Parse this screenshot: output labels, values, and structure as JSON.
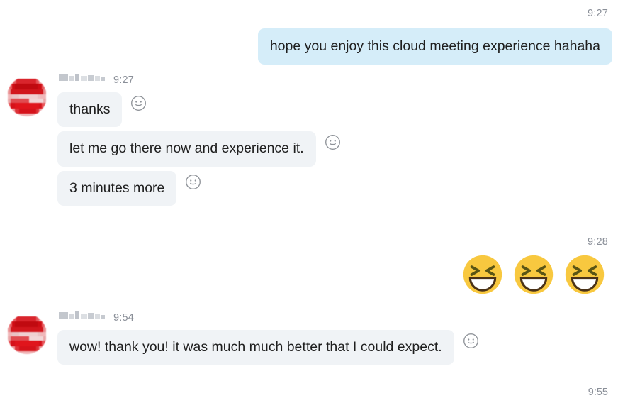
{
  "app": {
    "title": "Chat conversation",
    "background_color": "#ffffff"
  },
  "colors": {
    "outgoing_bubble": "#d5edf9",
    "incoming_bubble": "#f0f3f6",
    "timestamp_text": "#8a8f98",
    "message_text": "#1f1f1f",
    "avatar_red": "#dd0b12",
    "emoji_yellow": "#f7c842",
    "emoji_mouth_outline": "#4a3218",
    "reaction_icon_gray": "#8e9298"
  },
  "timestamps": {
    "first": "9:27",
    "sticker": "9:28",
    "bottom_cut_off": "9:55"
  },
  "messages": [
    {
      "id": "msg-outgoing-1",
      "direction": "outgoing",
      "text": "hope you enjoy this cloud meeting experience hahaha",
      "time": "9:27"
    },
    {
      "id": "msg-incoming-group-1",
      "direction": "incoming",
      "sender_name_redacted": true,
      "sender_name": "",
      "time": "9:27",
      "avatar": "pixelated-red-avatar",
      "bubbles": [
        {
          "id": "msg-in-1",
          "text": "thanks",
          "reaction_button": "add-reaction-smiley-icon"
        },
        {
          "id": "msg-in-2",
          "text": "let me go there now and experience it.",
          "reaction_button": "add-reaction-smiley-icon"
        },
        {
          "id": "msg-in-3",
          "text": "3 minutes more",
          "reaction_button": "add-reaction-smiley-icon"
        }
      ]
    },
    {
      "id": "msg-outgoing-stickers",
      "direction": "outgoing",
      "time": "9:28",
      "stickers": [
        {
          "id": "sticker-1",
          "name": "grinning-squinting-face-emoji"
        },
        {
          "id": "sticker-2",
          "name": "grinning-squinting-face-emoji"
        },
        {
          "id": "sticker-3",
          "name": "grinning-squinting-face-emoji"
        }
      ]
    },
    {
      "id": "msg-incoming-group-2",
      "direction": "incoming",
      "sender_name_redacted": true,
      "sender_name": "",
      "time": "9:54",
      "avatar": "pixelated-red-avatar",
      "bubbles": [
        {
          "id": "msg-in-4",
          "text": "wow! thank you! it was much much better that I could expect.",
          "reaction_button": "add-reaction-smiley-icon"
        }
      ]
    }
  ]
}
